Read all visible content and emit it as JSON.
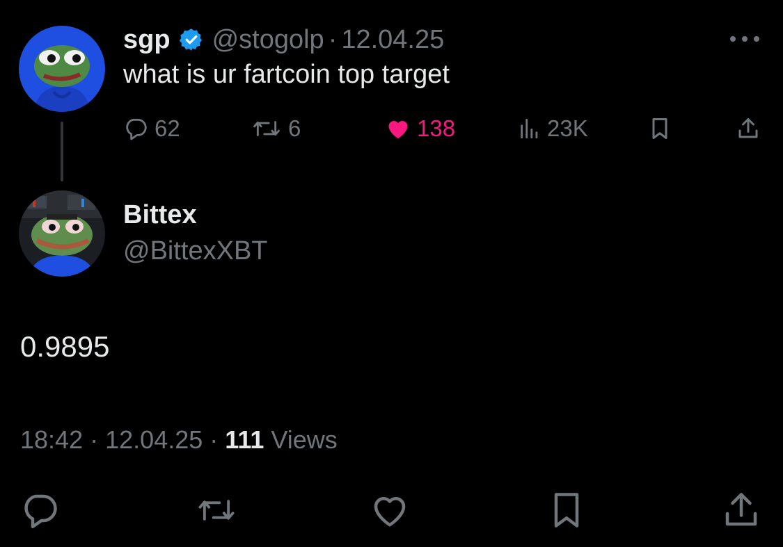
{
  "parent_tweet": {
    "display_name": "sgp",
    "handle": "@stogolp",
    "separator": "·",
    "date": "12.04.25",
    "text": "what is ur fartcoin top target",
    "replies": "62",
    "retweets": "6",
    "likes": "138",
    "views": "23K",
    "liked": true
  },
  "reply_tweet": {
    "display_name": "Bittex",
    "handle": "@BittexXBT",
    "text": "0.9895",
    "time": "18:42",
    "separator": "·",
    "date": "12.04.25",
    "separator2": "·",
    "views_count": "111",
    "views_label": "Views"
  },
  "colors": {
    "background": "#000000",
    "primary_text": "#e7e9ea",
    "secondary_text": "#71767b",
    "like": "#f91880",
    "verified": "#1d9bf0",
    "avatar_blue": "#1f4fe0"
  },
  "icons": {
    "reply": "reply-icon",
    "retweet": "retweet-icon",
    "like": "heart-icon",
    "views": "views-chart-icon",
    "bookmark": "bookmark-icon",
    "share": "share-icon",
    "more": "more-dots-icon",
    "verified": "verified-badge-icon"
  }
}
